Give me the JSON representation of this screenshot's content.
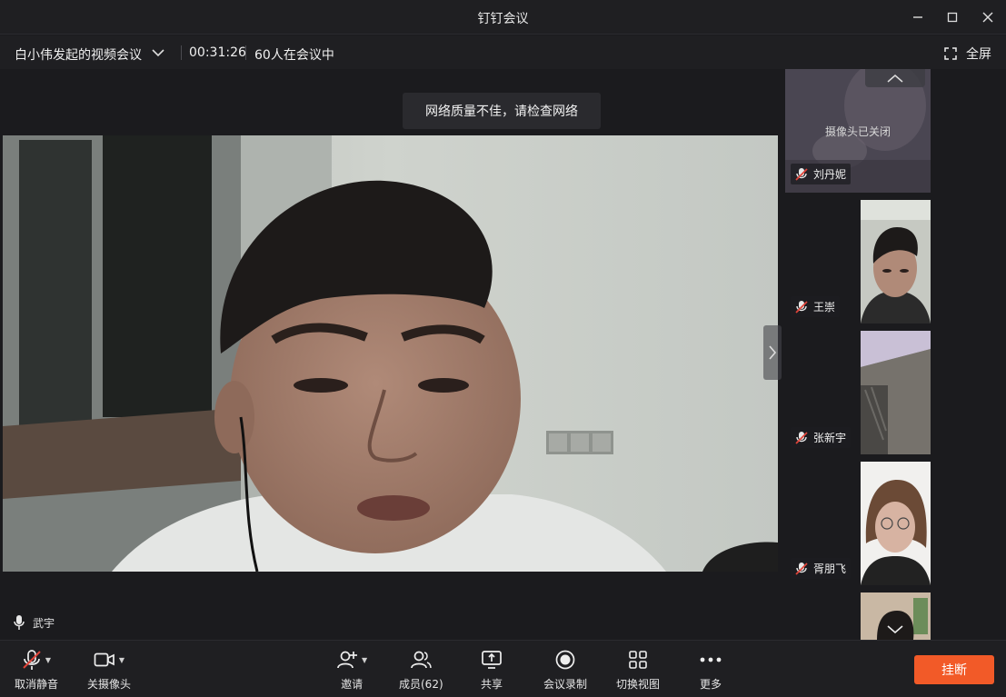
{
  "window": {
    "title": "钉钉会议"
  },
  "infobar": {
    "meeting_title": "白小伟发起的视频会议",
    "timer": "00:31:26",
    "participants_text": "60人在会议中",
    "fullscreen_label": "全屏"
  },
  "stage": {
    "network_toast": "网络质量不佳，请检查网络",
    "speaker_name": "武宇"
  },
  "panel": {
    "top_tile": {
      "name": "刘丹妮",
      "status": "摄像头已关闭"
    },
    "tiles": [
      {
        "name": "王崇"
      },
      {
        "name": "张新宇"
      },
      {
        "name": "胥朋飞"
      }
    ]
  },
  "toolbar": {
    "unmute_label": "取消静音",
    "camera_off_label": "关摄像头",
    "invite_label": "邀请",
    "members_label": "成员(62)",
    "share_label": "共享",
    "record_label": "会议录制",
    "switch_view_label": "切换视图",
    "more_label": "更多",
    "hangup_label": "挂断"
  },
  "colors": {
    "hangup": "#f25a28",
    "background": "#1b1b1e",
    "mute_red": "#e0443a"
  }
}
